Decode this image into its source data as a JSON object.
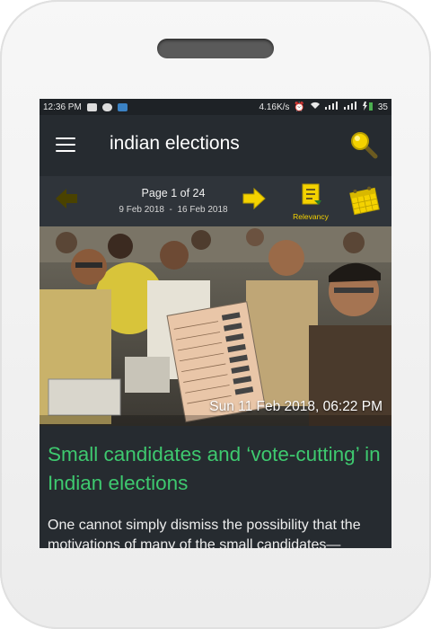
{
  "status_bar": {
    "time": "12:36 PM",
    "network_speed": "4.16K/s",
    "battery": "35"
  },
  "header": {
    "title": "indian elections",
    "menu_icon": "hamburger-menu-icon",
    "search_icon": "magnifier-icon"
  },
  "pager": {
    "page_label": "Page 1 of 24",
    "date_from": "9 Feb 2018",
    "date_separator": "-",
    "date_to": "16 Feb 2018",
    "sort_label": "Relevancy"
  },
  "article": {
    "timestamp": "Sun 11 Feb 2018, 06:22 PM",
    "title": "Small candidates and ‘vote-cutting’ in Indian elections",
    "excerpt": "One cannot simply dismiss the possibility that the motivations of many of the small candidates—"
  },
  "colors": {
    "accent_yellow": "#f4d200",
    "title_green": "#3ec96f",
    "screen_bg": "#262b30"
  }
}
